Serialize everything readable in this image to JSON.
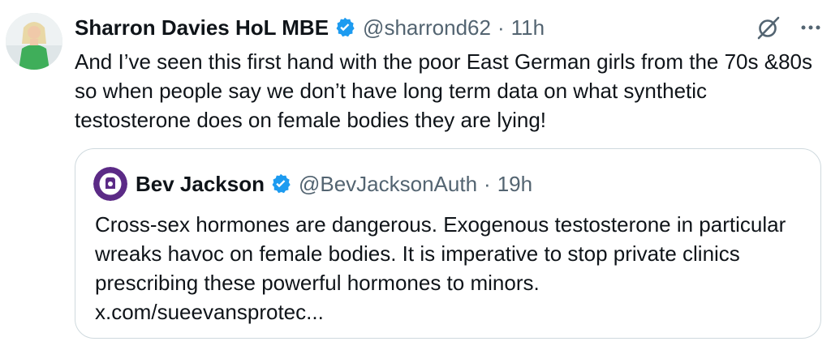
{
  "tweet": {
    "author_name": "Sharron Davies HoL MBE",
    "handle": "@sharrond62",
    "separator": "·",
    "time": "11h",
    "text": "And I’ve seen this first hand with the poor East German girls from the 70s &80s so when people say we don’t have long term data on what synthetic testosterone does on female bodies they are lying!"
  },
  "quote": {
    "author_name": "Bev Jackson",
    "handle": "@BevJacksonAuth",
    "separator": "·",
    "time": "19h",
    "text": "Cross-sex hormones are dangerous. Exogenous testosterone in particular wreaks havoc on female bodies. It is imperative to stop private clinics prescribing these powerful hormones to minors.",
    "link": "x.com/sueevansprotec..."
  },
  "icons": {
    "verified": "verified-badge-icon",
    "grok": "grok-icon",
    "more": "more-icon"
  },
  "colors": {
    "verified_blue": "#1d9bf0",
    "secondary_text": "#536471",
    "border": "#cfd9de",
    "quote_avatar_purple": "#5b2a86"
  }
}
